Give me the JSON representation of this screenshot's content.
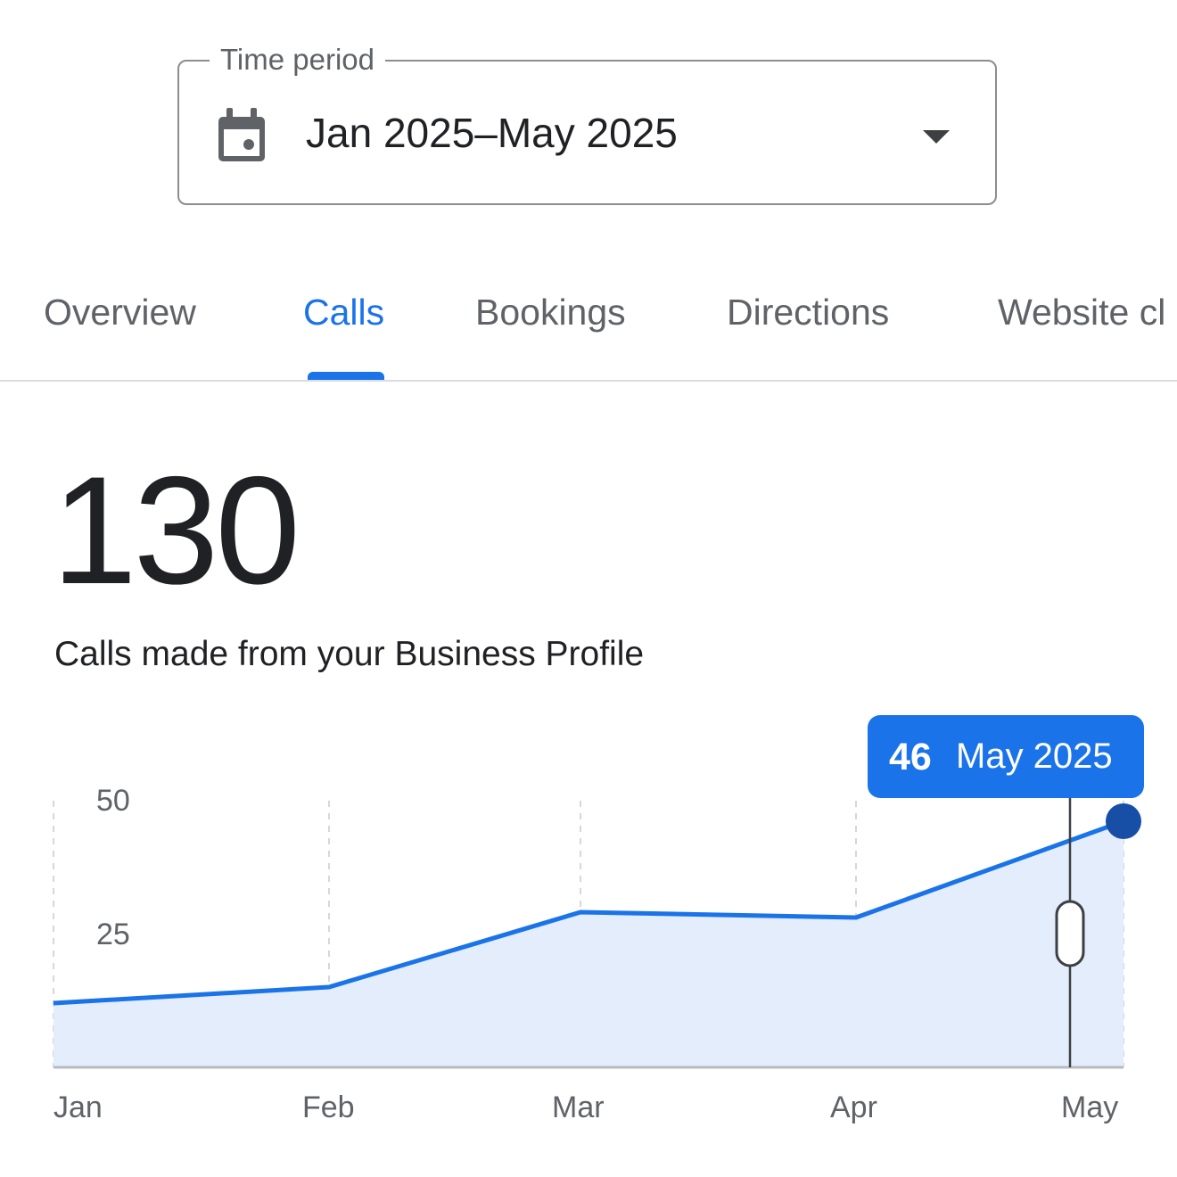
{
  "time_period": {
    "label": "Time period",
    "value": "Jan 2025–May 2025",
    "icon": "calendar-icon",
    "dropdown_icon": "dropdown-arrow-icon"
  },
  "tabs": [
    {
      "label": "Overview",
      "active": false
    },
    {
      "label": "Calls",
      "active": true
    },
    {
      "label": "Bookings",
      "active": false
    },
    {
      "label": "Directions",
      "active": false
    },
    {
      "label": "Website cl",
      "active": false
    }
  ],
  "metric": {
    "value": "130",
    "caption": "Calls made from your Business Profile"
  },
  "colors": {
    "accent": "#1a73e8",
    "fill": "#e3edfb",
    "point": "#174ea6",
    "text": "#202124",
    "muted": "#5f6368"
  },
  "chart_data": {
    "type": "area",
    "x": [
      "Jan",
      "Feb",
      "Mar",
      "Apr",
      "May"
    ],
    "series": [
      {
        "values": [
          12,
          15,
          29,
          28,
          46
        ]
      }
    ],
    "ylim": [
      0,
      50
    ],
    "yticks": [
      25,
      50
    ],
    "grid": "vertical-dashed",
    "tooltip": {
      "value": "46",
      "label": "May 2025"
    }
  }
}
